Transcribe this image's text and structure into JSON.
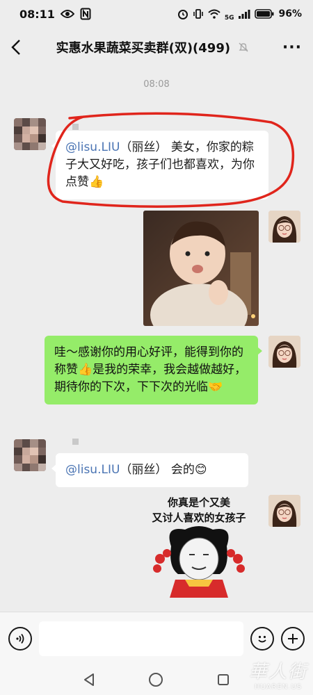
{
  "status_bar": {
    "time": "08:11",
    "battery_text": "96%",
    "network_text": "5G",
    "left_icons": [
      "eye-icon",
      "nfc-icon"
    ],
    "right_icons": [
      "alarm-icon",
      "vibrate-icon",
      "wifi-icon",
      "signal-icon",
      "battery-icon"
    ]
  },
  "header": {
    "title": "实惠水果蔬菜买卖群(双)(499)",
    "back_icon": "chevron-left-icon",
    "mute_icon": "bell-off-icon",
    "more_label": "···"
  },
  "chat": {
    "timestamp": "08:08",
    "messages": [
      {
        "id": 1,
        "side": "left",
        "kind": "text",
        "mention": "@lisu.LIU",
        "text_after_mention": "（丽丝） 美女，你家的粽子大又好吃，孩子们也都喜欢，为你点赞",
        "emoji": "👍"
      },
      {
        "id": 2,
        "side": "right",
        "kind": "image",
        "description_icon": "photo-toddler"
      },
      {
        "id": 3,
        "side": "right",
        "kind": "text",
        "text_1": "哇～感谢你的用心好评，能得到你的称赞",
        "emoji_1": "👍",
        "text_2": "是我的荣幸，我会越做越好，期待你的下次，下下次的光临",
        "emoji_2": "🤝"
      },
      {
        "id": 4,
        "side": "left",
        "kind": "text",
        "mention": "@lisu.LIU",
        "text_after_mention": "（丽丝） 会的",
        "emoji": "😊"
      },
      {
        "id": 5,
        "side": "right",
        "kind": "sticker",
        "caption_line_1": "你真是个又美",
        "caption_line_2": "又讨人喜欢的女孩子"
      }
    ]
  },
  "input_bar": {
    "voice_icon": "voice-icon",
    "emoji_icon": "smile-icon",
    "plus_icon": "plus-icon",
    "placeholder": ""
  },
  "system_nav": {
    "back_icon": "triangle-back-icon",
    "home_icon": "circle-home-icon",
    "recent_icon": "square-recent-icon"
  },
  "watermark": {
    "cn": "華人街",
    "en": "HUAREN.US"
  },
  "colors": {
    "background": "#ededed",
    "green_bubble": "#95ec69",
    "white_bubble": "#ffffff",
    "mention": "#4a74b3",
    "annotation_red": "#e0251c"
  }
}
